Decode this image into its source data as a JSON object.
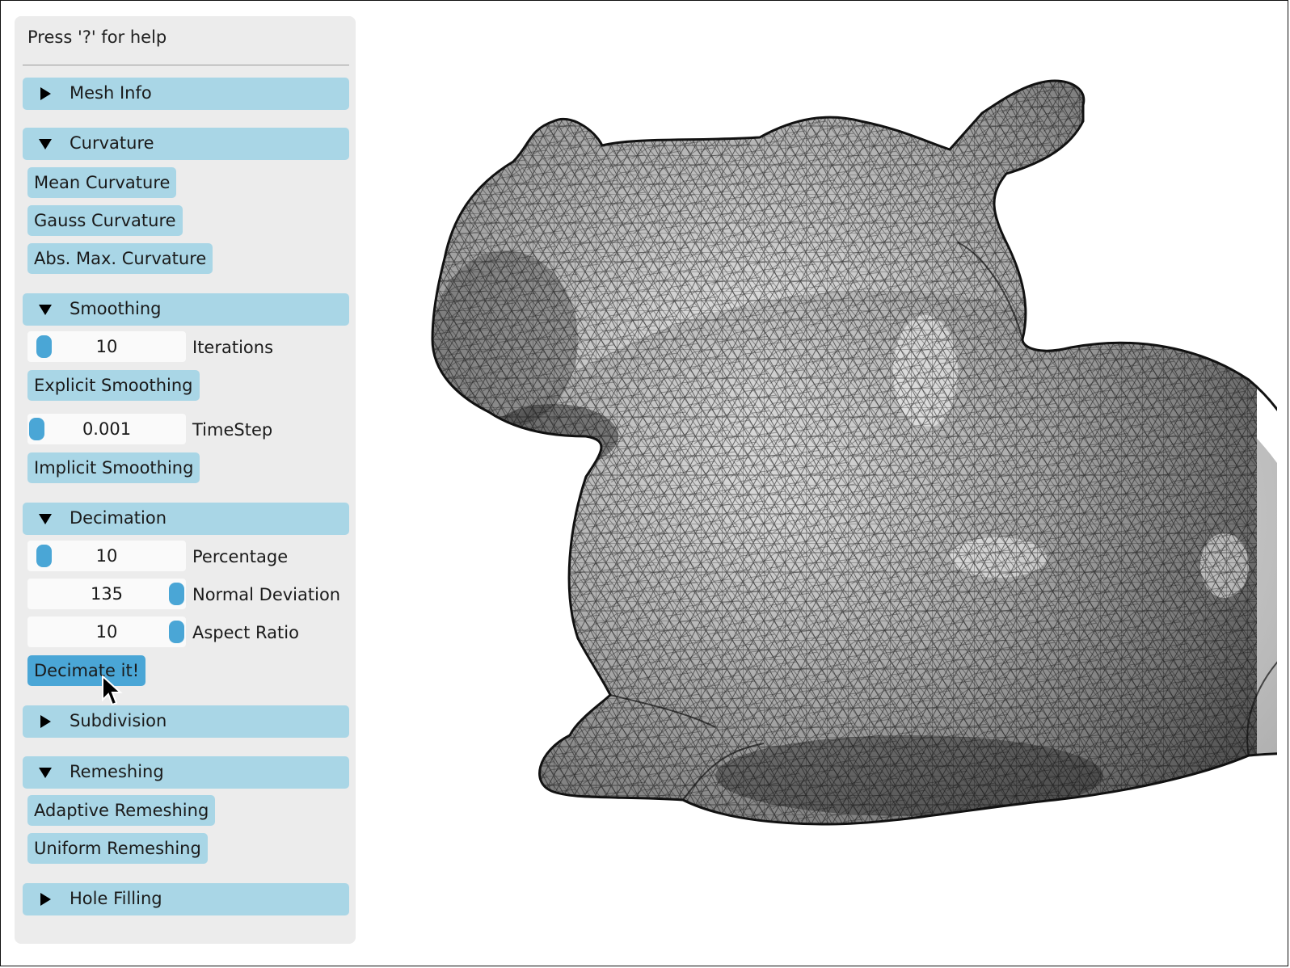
{
  "help_text": "Press '?' for help",
  "sections": {
    "mesh_info": {
      "label": "Mesh Info",
      "expanded": false
    },
    "curvature": {
      "label": "Curvature",
      "expanded": true,
      "buttons": {
        "mean": "Mean Curvature",
        "gauss": "Gauss Curvature",
        "absmax": "Abs. Max. Curvature"
      }
    },
    "smoothing": {
      "label": "Smoothing",
      "expanded": true,
      "iterations": {
        "value": "10",
        "label": "Iterations",
        "level": 0.05
      },
      "explicit_button": "Explicit Smoothing",
      "timestep": {
        "value": "0.001",
        "label": "TimeStep",
        "level": 0.0
      },
      "implicit_button": "Implicit Smoothing"
    },
    "decimation": {
      "label": "Decimation",
      "expanded": true,
      "percentage": {
        "value": "10",
        "label": "Percentage",
        "level": 0.05
      },
      "normal_deviation": {
        "value": "135",
        "label": "Normal Deviation",
        "level": 1.0
      },
      "aspect_ratio": {
        "value": "10",
        "label": "Aspect Ratio",
        "level": 1.0
      },
      "decimate_button": "Decimate it!"
    },
    "subdivision": {
      "label": "Subdivision",
      "expanded": false
    },
    "remeshing": {
      "label": "Remeshing",
      "expanded": true,
      "buttons": {
        "adaptive": "Adaptive Remeshing",
        "uniform": "Uniform Remeshing"
      }
    },
    "hole_filling": {
      "label": "Hole Filling",
      "expanded": false
    }
  },
  "colors": {
    "section_bg": "#a9d6e6",
    "active_button": "#4aa6d6",
    "panel_bg": "#ececec"
  },
  "icons": {
    "collapsed": "triangle-right-icon",
    "expanded": "triangle-down-icon",
    "cursor": "mouse-pointer-icon"
  }
}
